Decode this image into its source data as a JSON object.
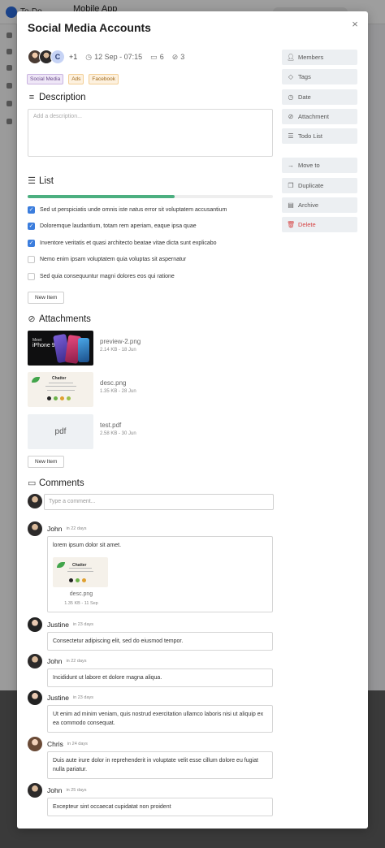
{
  "background": {
    "logo_text": "To-Do",
    "title": "Mobile App"
  },
  "modal": {
    "title": "Social Media Accounts",
    "close_icon": "×",
    "meta": {
      "more_count": "+1",
      "avatar_initial": "C",
      "date": "12 Sep - 07:15",
      "comments_count": "6",
      "attachments_count": "3"
    },
    "tags": [
      "Social Media",
      "Ads",
      "Facebook"
    ]
  },
  "description": {
    "title": "Description",
    "placeholder": "Add a description..."
  },
  "list": {
    "title": "List",
    "progress": 0.6,
    "items": [
      {
        "text": "Sed ut perspiciatis unde omnis iste natus error sit voluptatem accusantium",
        "done": true
      },
      {
        "text": "Doloremque laudantium, totam rem aperiam, eaque ipsa quae",
        "done": true
      },
      {
        "text": "Inventore veritatis et quasi architecto beatae vitae dicta sunt explicabo",
        "done": true
      },
      {
        "text": "Nemo enim ipsam voluptatem quia voluptas sit aspernatur",
        "done": false
      },
      {
        "text": "Sed quia consequuntur magni dolores eos qui ratione",
        "done": false
      }
    ],
    "new_item_label": "New Item"
  },
  "attachments": {
    "title": "Attachments",
    "files": [
      {
        "name": "preview-2.png",
        "meta": "2.14 KB - 18 Jun",
        "thumb_line1": "Meet",
        "thumb_line2": "iPhone 9"
      },
      {
        "name": "desc.png",
        "meta": "1.35 KB - 28 Jun",
        "thumb_title": "Chatter"
      },
      {
        "name": "test.pdf",
        "meta": "2.58 KB - 30 Jun",
        "thumb_label": "pdf"
      }
    ],
    "new_item_label": "New Item"
  },
  "comments": {
    "title": "Comments",
    "input_placeholder": "Type a comment...",
    "items": [
      {
        "author": "John",
        "time": "in 22 days",
        "text": "lorem ipsum dolor sit amet.",
        "attachment": {
          "name": "desc.png",
          "meta": "1.35 KB - 11 Sep",
          "thumb_title": "Chatter"
        }
      },
      {
        "author": "Justine",
        "time": "in 23 days",
        "text": "Consectetur adipiscing elit, sed do eiusmod tempor."
      },
      {
        "author": "John",
        "time": "in 22 days",
        "text": "Incididunt ut labore et dolore magna aliqua."
      },
      {
        "author": "Justine",
        "time": "in 23 days",
        "text": "Ut enim ad minim veniam, quis nostrud exercitation ullamco laboris nisi ut aliquip ex ea commodo consequat."
      },
      {
        "author": "Chris",
        "time": "in 24 days",
        "text": "Duis aute irure dolor in reprehenderit in voluptate velit esse cillum dolore eu fugiat nulla pariatur."
      },
      {
        "author": "John",
        "time": "in 25 days",
        "text": "Excepteur sint occaecat cupidatat non proident"
      }
    ]
  },
  "sidebar": {
    "actions_top": [
      {
        "label": "Members",
        "icon": "user-icon"
      },
      {
        "label": "Tags",
        "icon": "tag-icon"
      },
      {
        "label": "Date",
        "icon": "clock-icon"
      },
      {
        "label": "Attachment",
        "icon": "paperclip-icon"
      },
      {
        "label": "Todo List",
        "icon": "checklist-icon"
      }
    ],
    "actions_bottom": [
      {
        "label": "Move to",
        "icon": "arrow-right-icon"
      },
      {
        "label": "Duplicate",
        "icon": "copy-icon"
      },
      {
        "label": "Archive",
        "icon": "archive-icon"
      },
      {
        "label": "Delete",
        "icon": "trash-icon",
        "danger_color": "#d64545"
      }
    ]
  }
}
